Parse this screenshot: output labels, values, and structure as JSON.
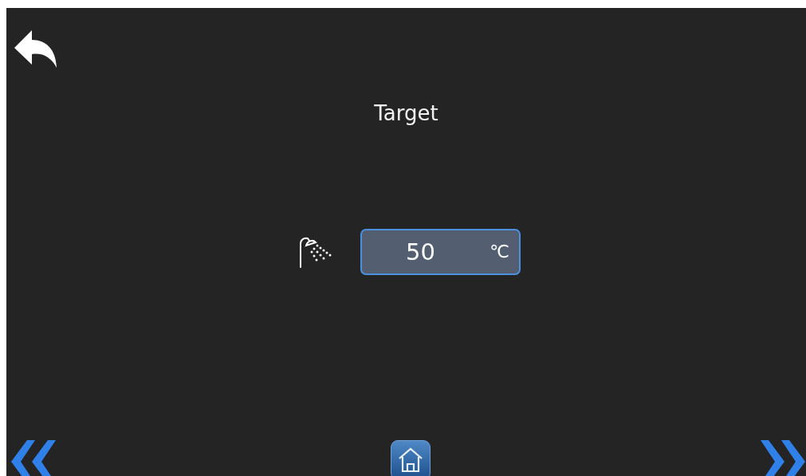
{
  "title": "Target",
  "setpoint": {
    "value": "50",
    "unit": "℃"
  }
}
